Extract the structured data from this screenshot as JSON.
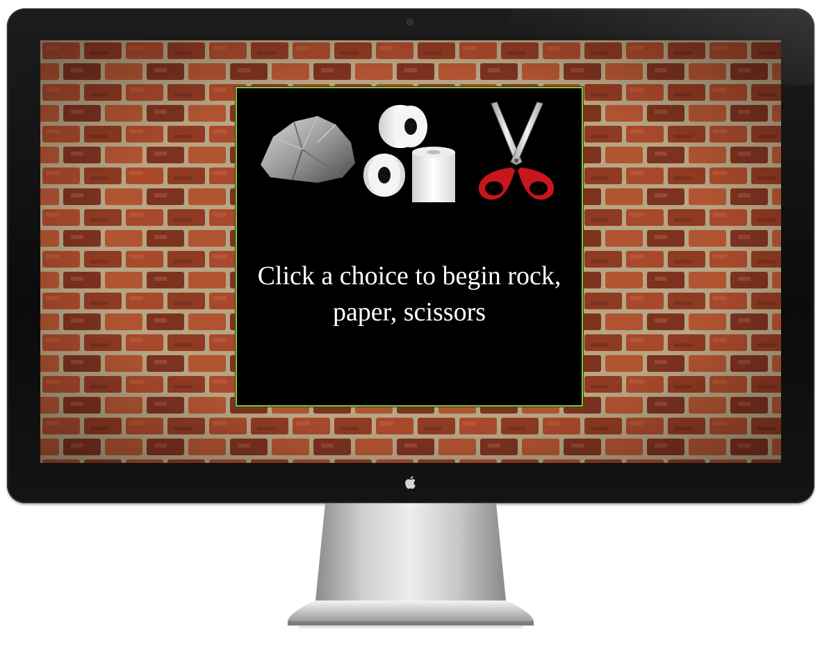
{
  "monitor": {
    "logo_icon": "apple-logo-icon"
  },
  "game": {
    "choices": [
      {
        "id": "rock",
        "icon": "rock-icon"
      },
      {
        "id": "paper",
        "icon": "toilet-paper-icon"
      },
      {
        "id": "scissors",
        "icon": "scissors-icon"
      }
    ],
    "prompt_line1": "Click a choice to begin rock,",
    "prompt_line2": "paper, scissors"
  },
  "colors": {
    "panel_background": "#000000",
    "panel_border": "#8cc43c",
    "prompt_text": "#ffffff",
    "scissors_handle": "#c8161d",
    "brick": "#a4482b",
    "mortar": "#b9a888"
  }
}
